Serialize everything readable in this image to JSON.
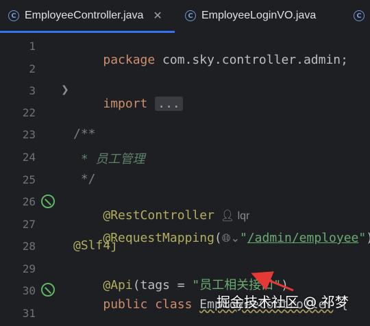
{
  "tabs": [
    {
      "label": "EmployeeController.java",
      "icon": "java-class-icon",
      "active": true,
      "close": "✕"
    },
    {
      "label": "EmployeeLoginVO.java",
      "icon": "java-class-icon",
      "active": false
    }
  ],
  "gutter": {
    "line_numbers": [
      "1",
      "2",
      "3",
      "22",
      "23",
      "24",
      "25",
      "26",
      "27",
      "28",
      "29",
      "30",
      "31"
    ]
  },
  "code": {
    "line1_kw": "package",
    "line1_rest": " com.sky.controller.admin;",
    "line3_kw": "import",
    "line3_fold": "...",
    "line23": "/**",
    "line24": " * 员工管理",
    "line25": " */",
    "line26_ann": "@RestController",
    "line26_author": "lqr",
    "line27_ann": "@RequestMapping",
    "line27_open": "(",
    "line27_quote_open": "\"",
    "line27_path": "/admin/employee",
    "line27_quote_close": "\"",
    "line27_close": ")",
    "line28_ann": "@Slf4j",
    "line29_ann": "@Api",
    "line29_mid": "(tags = ",
    "line29_str": "\"员工相关接口\"",
    "line29_close": ")",
    "line30_kw": "public class",
    "line30_name": "EmployeeController",
    "line30_brace": "{"
  },
  "watermark": "掘金技术社区 @ 祁梦",
  "colors": {
    "background": "#1e1f22",
    "keyword": "#cf8e6d",
    "annotation": "#b3ae60",
    "string": "#6aab73",
    "comment": "#7a7e85",
    "arrow": "#e53935"
  }
}
